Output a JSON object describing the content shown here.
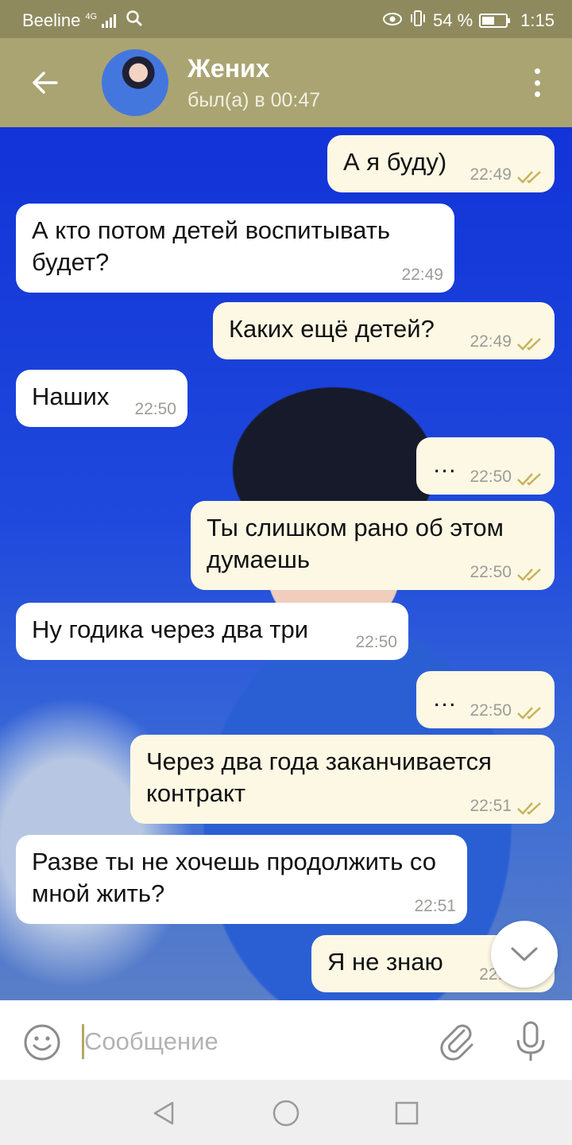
{
  "status_bar": {
    "carrier": "Beeline",
    "network": "4G",
    "battery_text": "54 %",
    "battery_level": 0.54,
    "time": "1:15"
  },
  "header": {
    "name": "Жених",
    "last_seen": "был(а) в 00:47"
  },
  "messages": [
    {
      "dir": "out",
      "text": "А я буду)",
      "time": "22:49"
    },
    {
      "dir": "in",
      "text": "А кто потом детей воспитывать будет?",
      "time": "22:49"
    },
    {
      "dir": "out",
      "text": "Каких ещё детей?",
      "time": "22:49"
    },
    {
      "dir": "in",
      "text": "Наших",
      "time": "22:50"
    },
    {
      "dir": "out",
      "text": "…",
      "time": "22:50"
    },
    {
      "dir": "out",
      "text": "Ты слишком рано об этом думаешь",
      "time": "22:50"
    },
    {
      "dir": "in",
      "text": "Ну годика через два три",
      "time": "22:50"
    },
    {
      "dir": "out",
      "text": "…",
      "time": "22:50"
    },
    {
      "dir": "out",
      "text": "Через два года заканчивается контракт",
      "time": "22:51"
    },
    {
      "dir": "in",
      "text": "Разве ты не хочешь продолжить со мной жить?",
      "time": "22:51"
    },
    {
      "dir": "out",
      "text": "Я не знаю",
      "time": "22:5"
    }
  ],
  "input": {
    "placeholder": "Сообщение"
  },
  "colors": {
    "header": "#a9a472",
    "status_bar": "#8f8a5e",
    "outgoing_bubble": "#fdf8e4",
    "incoming_bubble": "#ffffff",
    "read_ticks": "#c6b35a"
  },
  "icons": [
    "back-arrow-icon",
    "more-vert-icon",
    "check-double-icon",
    "chevron-down-icon",
    "emoji-icon",
    "paperclip-icon",
    "microphone-icon",
    "nav-back-icon",
    "nav-home-icon",
    "nav-recents-icon"
  ]
}
